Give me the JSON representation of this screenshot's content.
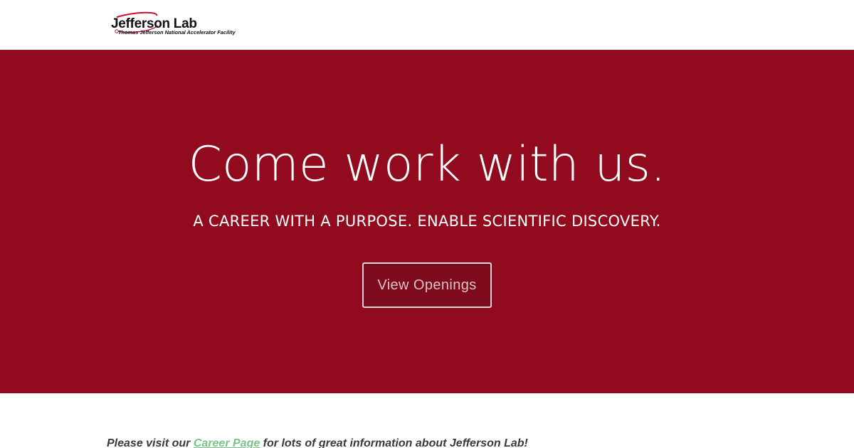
{
  "header": {
    "logo": {
      "title": "Jefferson Lab",
      "subtitle": "Thomas Jefferson National Accelerator Facility"
    }
  },
  "hero": {
    "title": "Come work with us.",
    "subtitle": "A CAREER WITH A PURPOSE. ENABLE SCIENTIFIC DISCOVERY.",
    "cta_label": "View Openings"
  },
  "info": {
    "text_before": "Please visit our ",
    "link_label": "Career Page",
    "text_after": " for lots of great information about Jefferson Lab!"
  },
  "colors": {
    "hero_background": "#910a1e",
    "link": "#79c288",
    "logo_swoosh": "#c8102e"
  }
}
